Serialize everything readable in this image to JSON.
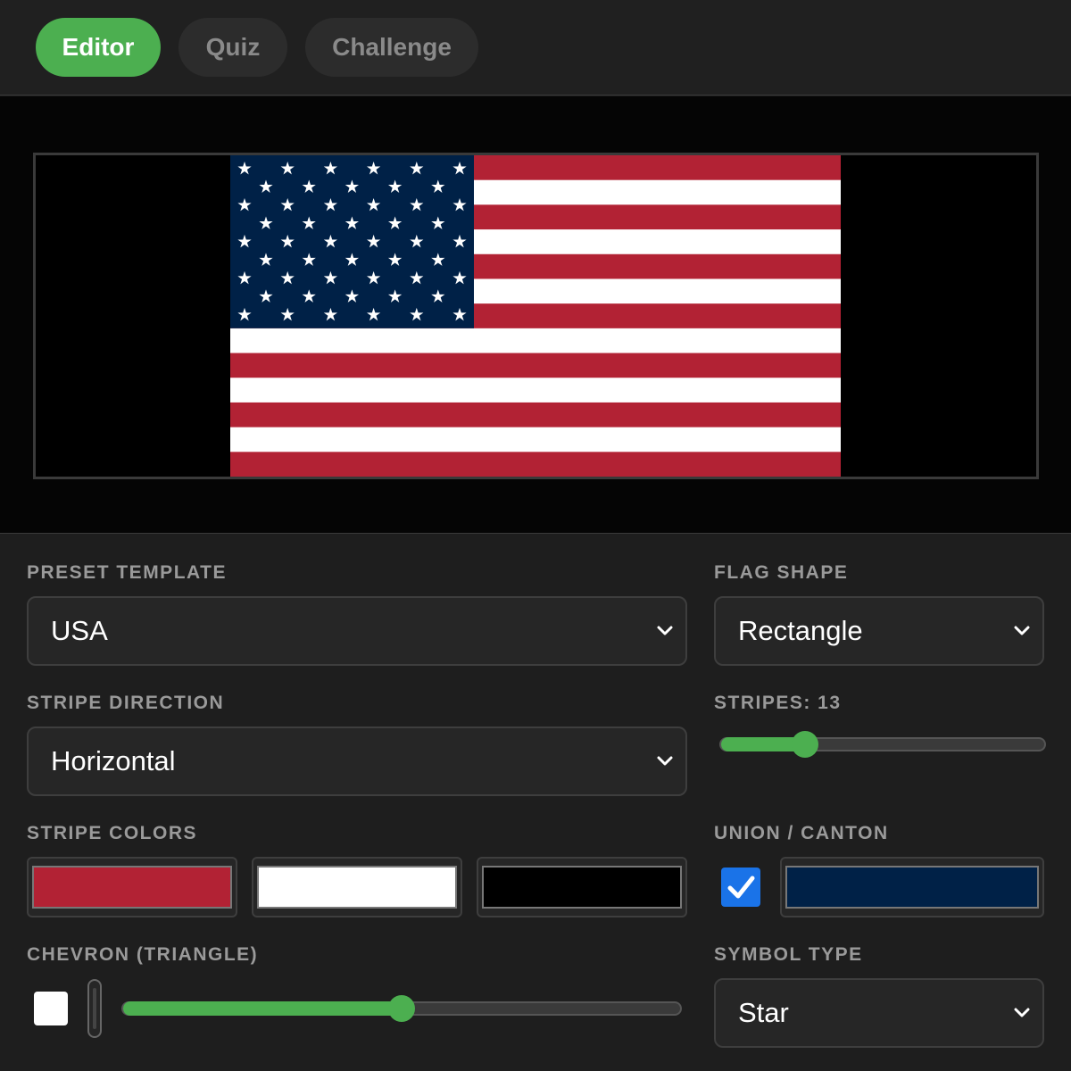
{
  "tabs": [
    {
      "label": "Editor",
      "active": true
    },
    {
      "label": "Quiz",
      "active": false
    },
    {
      "label": "Challenge",
      "active": false
    }
  ],
  "colors": {
    "accent": "#4caf50",
    "stripe_red": "#b22234",
    "stripe_white": "#ffffff",
    "stripe_black": "#000000",
    "union_navy": "#002147",
    "checkbox_blue": "#1a73e8"
  },
  "controls": {
    "preset_template": {
      "label": "PRESET TEMPLATE",
      "value": "USA"
    },
    "flag_shape": {
      "label": "FLAG SHAPE",
      "value": "Rectangle"
    },
    "stripe_direction": {
      "label": "STRIPE DIRECTION",
      "value": "Horizontal"
    },
    "stripes": {
      "label": "STRIPES: 13",
      "value": 13,
      "slider_fraction": 0.26
    },
    "stripe_colors": {
      "label": "STRIPE COLORS",
      "swatches": [
        "#b22234",
        "#ffffff",
        "#000000"
      ]
    },
    "union_canton": {
      "label": "UNION / CANTON",
      "enabled": true,
      "color": "#002147"
    },
    "chevron": {
      "label": "CHEVRON (TRIANGLE)",
      "enabled": false,
      "size_fraction": 0.5
    },
    "symbol_type": {
      "label": "SYMBOL TYPE",
      "value": "Star"
    }
  },
  "flag": {
    "stripes": 13,
    "union_rows": 9,
    "stars": 50,
    "icon": "star-icon"
  }
}
